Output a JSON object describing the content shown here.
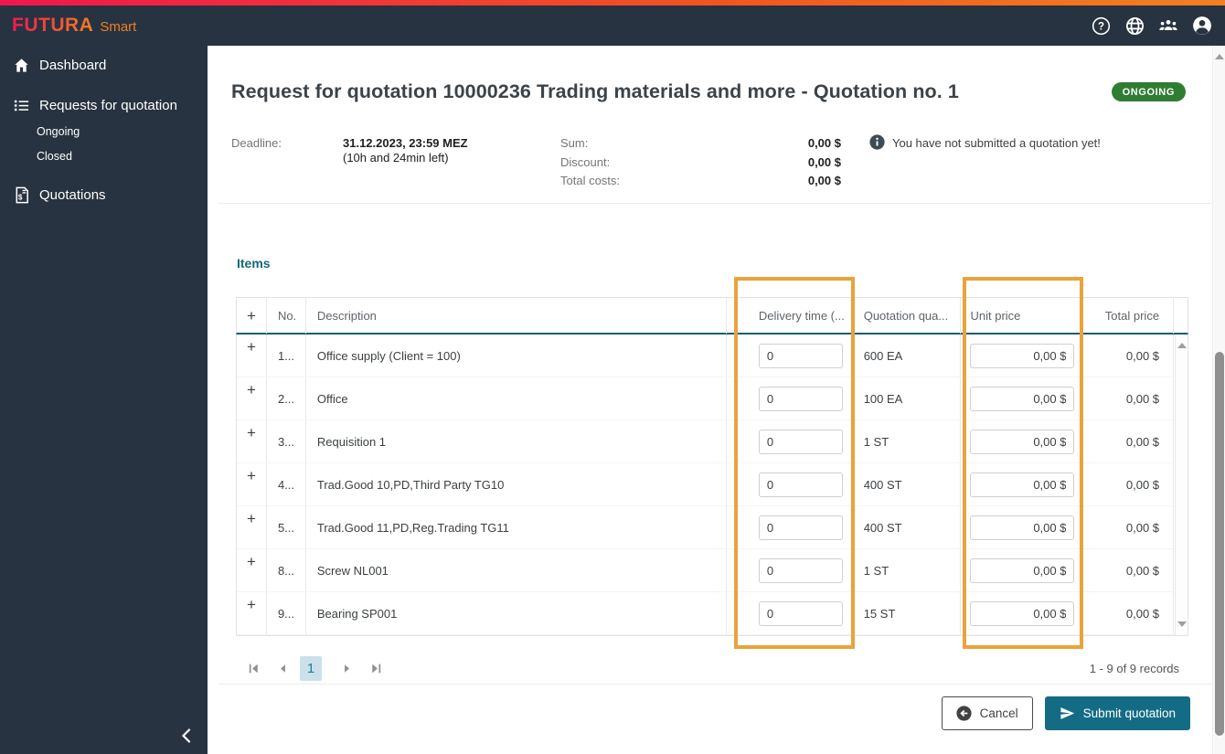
{
  "brand": {
    "name": "FUTURA",
    "suffix": "Smart"
  },
  "topbar": {
    "icons": [
      "help-icon",
      "language-icon",
      "team-icon",
      "account-icon"
    ]
  },
  "sidebar": {
    "dashboard": "Dashboard",
    "requests": "Requests for quotation",
    "ongoing": "Ongoing",
    "closed": "Closed",
    "quotations": "Quotations"
  },
  "header": {
    "title": "Request for quotation 10000236 Trading materials and more - Quotation no. 1",
    "status": "ONGOING"
  },
  "summary": {
    "deadline_label": "Deadline:",
    "deadline_value": "31.12.2023, 23:59 MEZ",
    "deadline_remaining": "(10h and 24min left)",
    "sum_label": "Sum:",
    "sum_value": "0,00 $",
    "discount_label": "Discount:",
    "discount_value": "0,00 $",
    "total_label": "Total costs:",
    "total_value": "0,00 $",
    "notice": "You have not submitted a quotation yet!"
  },
  "items": {
    "heading": "Items",
    "columns": {
      "expand": "+",
      "no": "No.",
      "description": "Description",
      "delivery": "Delivery time (...",
      "quantity": "Quotation qua...",
      "unit_price": "Unit price",
      "total_price": "Total price"
    },
    "rows": [
      {
        "no": "1...",
        "description": "Office supply (Client = 100)",
        "delivery": "0",
        "quantity": "600 EA",
        "unit_price": "0,00 $",
        "total": "0,00 $"
      },
      {
        "no": "2...",
        "description": "Office",
        "delivery": "0",
        "quantity": "100 EA",
        "unit_price": "0,00 $",
        "total": "0,00 $"
      },
      {
        "no": "3...",
        "description": "Requisition 1",
        "delivery": "0",
        "quantity": "1 ST",
        "unit_price": "0,00 $",
        "total": "0,00 $"
      },
      {
        "no": "4...",
        "description": "Trad.Good 10,PD,Third Party TG10",
        "delivery": "0",
        "quantity": "400 ST",
        "unit_price": "0,00 $",
        "total": "0,00 $"
      },
      {
        "no": "5...",
        "description": "Trad.Good 11,PD,Reg.Trading TG11",
        "delivery": "0",
        "quantity": "400 ST",
        "unit_price": "0,00 $",
        "total": "0,00 $"
      },
      {
        "no": "8...",
        "description": "Screw NL001",
        "delivery": "0",
        "quantity": "1 ST",
        "unit_price": "0,00 $",
        "total": "0,00 $"
      },
      {
        "no": "9...",
        "description": "Bearing SP001",
        "delivery": "0",
        "quantity": "15 ST",
        "unit_price": "0,00 $",
        "total": "0,00 $"
      }
    ],
    "pagination": {
      "page": "1",
      "records": "1 - 9 of 9 records"
    }
  },
  "footer": {
    "cancel": "Cancel",
    "submit": "Submit quotation"
  },
  "colors": {
    "topbar_dark": "#273340",
    "accent_teal": "#146c84",
    "badge_green": "#2f7d32",
    "highlight_orange": "#e9a33a",
    "gradient_start": "#f0164e",
    "gradient_end": "#f28022"
  }
}
